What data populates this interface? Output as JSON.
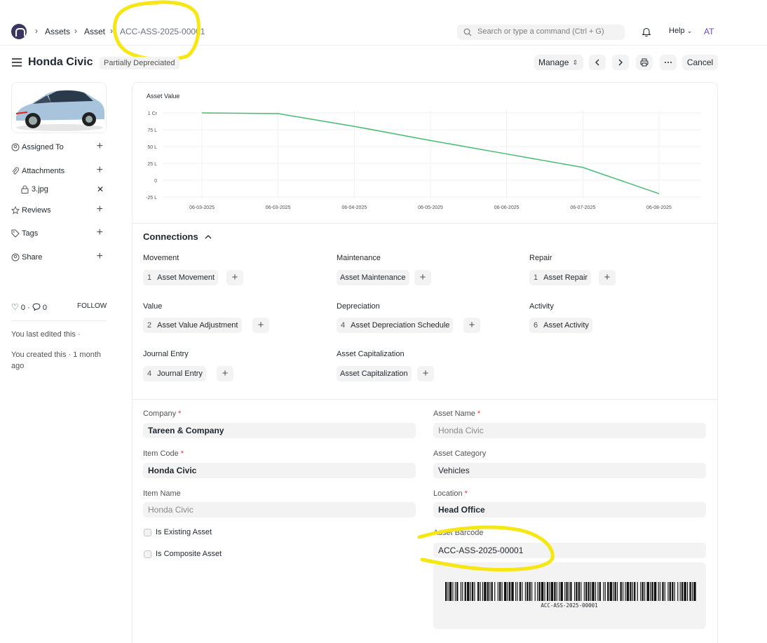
{
  "navbar": {
    "breadcrumbs": [
      "Assets",
      "Asset",
      "ACC-ASS-2025-00001"
    ],
    "search_placeholder": "Search or type a command (Ctrl + G)",
    "help_label": "Help",
    "avatar_initials": "AT"
  },
  "page": {
    "title": "Honda Civic",
    "status": "Partially Depreciated",
    "manage_label": "Manage",
    "cancel_label": "Cancel"
  },
  "sidebar": {
    "assigned_to": "Assigned To",
    "attachments": "Attachments",
    "attachment_file": "3.jpg",
    "reviews": "Reviews",
    "tags": "Tags",
    "share": "Share",
    "likes_count": "0",
    "comments_count": "0",
    "follow_label": "FOLLOW",
    "last_edited": "You last edited this ·",
    "created": "You created this · 1 month ago"
  },
  "chart_data": {
    "type": "line",
    "title": "Asset Value",
    "x": [
      "06-03-2025",
      "06-03-2025",
      "06-04-2025",
      "06-05-2025",
      "06-06-2025",
      "06-07-2025",
      "06-08-2025"
    ],
    "y_tick_labels": [
      "1 Cr",
      "75 L",
      "50 L",
      "25 L",
      "0",
      "-25 L"
    ],
    "series": [
      {
        "values": [
          100,
          99,
          80,
          59,
          39,
          19,
          -20
        ]
      }
    ],
    "ylim": [
      -25,
      100
    ],
    "grid": true,
    "line_color": "#48bb74"
  },
  "connections": {
    "title": "Connections",
    "groups": [
      {
        "label": "Movement",
        "items": [
          {
            "count": "1",
            "name": "Asset Movement"
          }
        ]
      },
      {
        "label": "Maintenance",
        "items": [
          {
            "count": "",
            "name": "Asset Maintenance"
          }
        ]
      },
      {
        "label": "Repair",
        "items": [
          {
            "count": "1",
            "name": "Asset Repair"
          }
        ]
      },
      {
        "label": "Value",
        "items": [
          {
            "count": "2",
            "name": "Asset Value Adjustment"
          }
        ]
      },
      {
        "label": "Depreciation",
        "items": [
          {
            "count": "4",
            "name": "Asset Depreciation Schedule"
          }
        ]
      },
      {
        "label": "Activity",
        "items": [
          {
            "count": "6",
            "name": "Asset Activity"
          }
        ]
      },
      {
        "label": "Journal Entry",
        "items": [
          {
            "count": "4",
            "name": "Journal Entry"
          }
        ]
      },
      {
        "label": "Asset Capitalization",
        "items": [
          {
            "count": "",
            "name": "Asset Capitalization"
          }
        ]
      }
    ]
  },
  "form": {
    "company_label": "Company",
    "company_value": "Tareen & Company",
    "item_code_label": "Item Code",
    "item_code_value": "Honda Civic",
    "item_name_label": "Item Name",
    "item_name_value": "Honda Civic",
    "is_existing_label": "Is Existing Asset",
    "is_composite_label": "Is Composite Asset",
    "asset_name_label": "Asset Name",
    "asset_name_value": "Honda Civic",
    "asset_category_label": "Asset Category",
    "asset_category_value": "Vehicles",
    "location_label": "Location",
    "location_value": "Head Office",
    "barcode_label": "Asset Barcode",
    "barcode_value": "ACC-ASS-2025-00001",
    "barcode_caption": "ACC-ASS-2025-00001"
  },
  "colors": {
    "accent": "#3b3561",
    "chart_line": "#48bb74",
    "highlight": "#f5e614",
    "required": "#e03636"
  }
}
